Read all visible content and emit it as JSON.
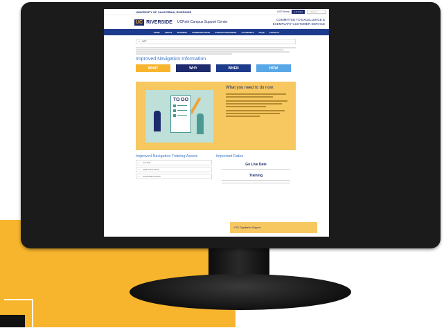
{
  "header": {
    "university": "UNIVERSITY OF CALIFORNIA, RIVERSIDE",
    "home_link": "UCR Home",
    "a_z_label": "A-Z Index",
    "search_placeholder": "Search",
    "logo_uc": "UC",
    "logo_riverside": "RIVERSIDE",
    "site_name": "UCPath Campus Support Center",
    "tagline": "COMMITTED TO EXCELLENCE & EXEMPLARY CUSTOMER SERVICE"
  },
  "nav": {
    "items": [
      "HOME",
      "ABOUT",
      "TRAINING",
      "COMMUNICATION",
      "CAMPUS PROVIDERS",
      "ACADEMICS",
      "FAQS",
      "CONTACT"
    ]
  },
  "breadcrumb": "NFT",
  "page": {
    "heading": "Improved Navigation Information",
    "tabs": [
      "WHAT",
      "WHY",
      "WHEN",
      "HOW"
    ]
  },
  "feature": {
    "title": "What you need to do now:",
    "todo_label": "TO DO"
  },
  "assets": {
    "heading": "Improved Navigation Training Assets",
    "items": [
      "Job Aids",
      "UCR Cheat Sheet",
      "Presentation Decks"
    ]
  },
  "dates": {
    "heading": "Important Dates",
    "go_live": "Go Live Date",
    "training": "Training"
  },
  "footer_link": "CSC Dignitaries Support",
  "colors": {
    "navy": "#1d2a6b",
    "nav_blue": "#1d3b8c",
    "gold": "#f7b52d",
    "tab_what": "#f7b52d",
    "tab_why": "#1d2a6b",
    "tab_when": "#1d3b8c",
    "tab_how": "#58a8e8"
  }
}
